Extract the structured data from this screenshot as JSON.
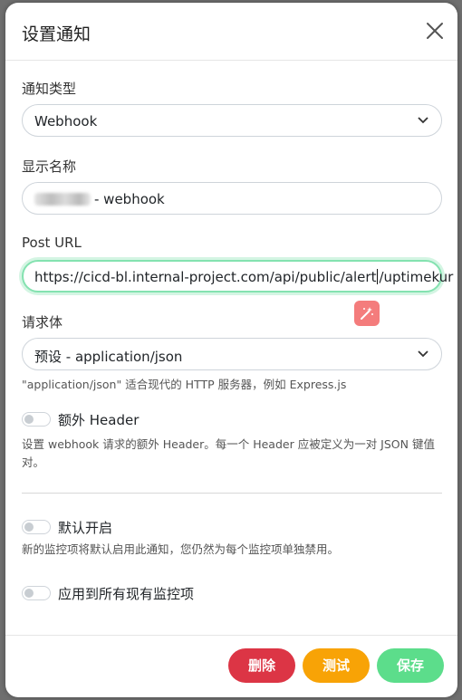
{
  "dialog": {
    "title": "设置通知",
    "close_icon": "close-icon"
  },
  "form": {
    "notify_type": {
      "label": "通知类型",
      "value": "Webhook"
    },
    "display_name": {
      "label": "显示名称",
      "value_suffix": "- webhook"
    },
    "post_url": {
      "label": "Post URL",
      "value_before_caret": "https://cicd-bl.internal-project.com/api/public/alert",
      "value_after_caret": "/uptimekur"
    },
    "request_body": {
      "label": "请求体",
      "value": "预设 - application/json",
      "hint": "\"application/json\" 适合现代的 HTTP 服务器，例如 Express.js"
    },
    "extra_header": {
      "label": "额外 Header",
      "enabled": false,
      "hint": "设置 webhook 请求的额外 Header。每一个 Header 应被定义为一对 JSON 键值对。"
    },
    "default_enabled": {
      "label": "默认开启",
      "enabled": false,
      "hint": "新的监控项将默认启用此通知，您仍然为每个监控项单独禁用。"
    },
    "apply_existing": {
      "label": "应用到所有现有监控项",
      "enabled": false
    }
  },
  "buttons": {
    "delete": "删除",
    "test": "测试",
    "save": "保存"
  },
  "colors": {
    "delete": "#dc3545",
    "test": "#f8a306",
    "save": "#5cdd8b",
    "focus_ring": "#84e2b0",
    "magic_button": "#f47c7c"
  }
}
